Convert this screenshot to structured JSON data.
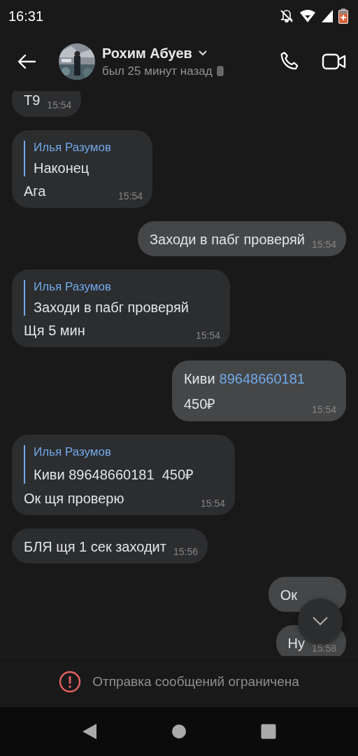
{
  "status_bar": {
    "time": "16:31"
  },
  "header": {
    "name": "Рохим Абуев",
    "status": "был 25 минут назад"
  },
  "messages": [
    {
      "kind": "in",
      "lines": [
        [
          {
            "kind": "plain",
            "text": "Т9"
          }
        ]
      ],
      "time": "15:54"
    },
    {
      "kind": "in",
      "reply": {
        "author": "Илья Разумов",
        "text": "Наконец"
      },
      "lines": [
        [
          {
            "kind": "plain",
            "text": "Ага"
          }
        ]
      ],
      "time": "15:54"
    },
    {
      "kind": "out",
      "lines": [
        [
          {
            "kind": "plain",
            "text": "Заходи в пабг проверяй"
          }
        ]
      ],
      "time": "15:54"
    },
    {
      "kind": "in",
      "reply": {
        "author": "Илья Разумов",
        "text": "Заходи в пабг проверяй"
      },
      "lines": [
        [
          {
            "kind": "plain",
            "text": "Щя 5 мин"
          }
        ]
      ],
      "time": "15:54"
    },
    {
      "kind": "out",
      "lines": [
        [
          {
            "kind": "plain",
            "text": "Киви"
          },
          {
            "kind": "link",
            "text": "89648660181"
          }
        ],
        [
          {
            "kind": "plain",
            "text": "450₽"
          }
        ]
      ],
      "time": "15:54"
    },
    {
      "kind": "in",
      "reply": {
        "author": "Илья Разумов",
        "text": "Киви 89648660181  450₽"
      },
      "lines": [
        [
          {
            "kind": "plain",
            "text": "Ок щя проверю"
          }
        ]
      ],
      "time": "15:54"
    },
    {
      "kind": "in",
      "lines": [
        [
          {
            "kind": "plain",
            "text": "БЛЯ щя 1 сек заходит"
          }
        ]
      ],
      "time": "15:56"
    },
    {
      "kind": "out",
      "lines": [
        [
          {
            "kind": "plain",
            "text": "Ок"
          }
        ]
      ]
    },
    {
      "kind": "out",
      "lines": [
        [
          {
            "kind": "plain",
            "text": "Ну"
          }
        ]
      ],
      "time": "15:58"
    }
  ],
  "notice": {
    "text": "Отправка сообщений ограничена"
  }
}
